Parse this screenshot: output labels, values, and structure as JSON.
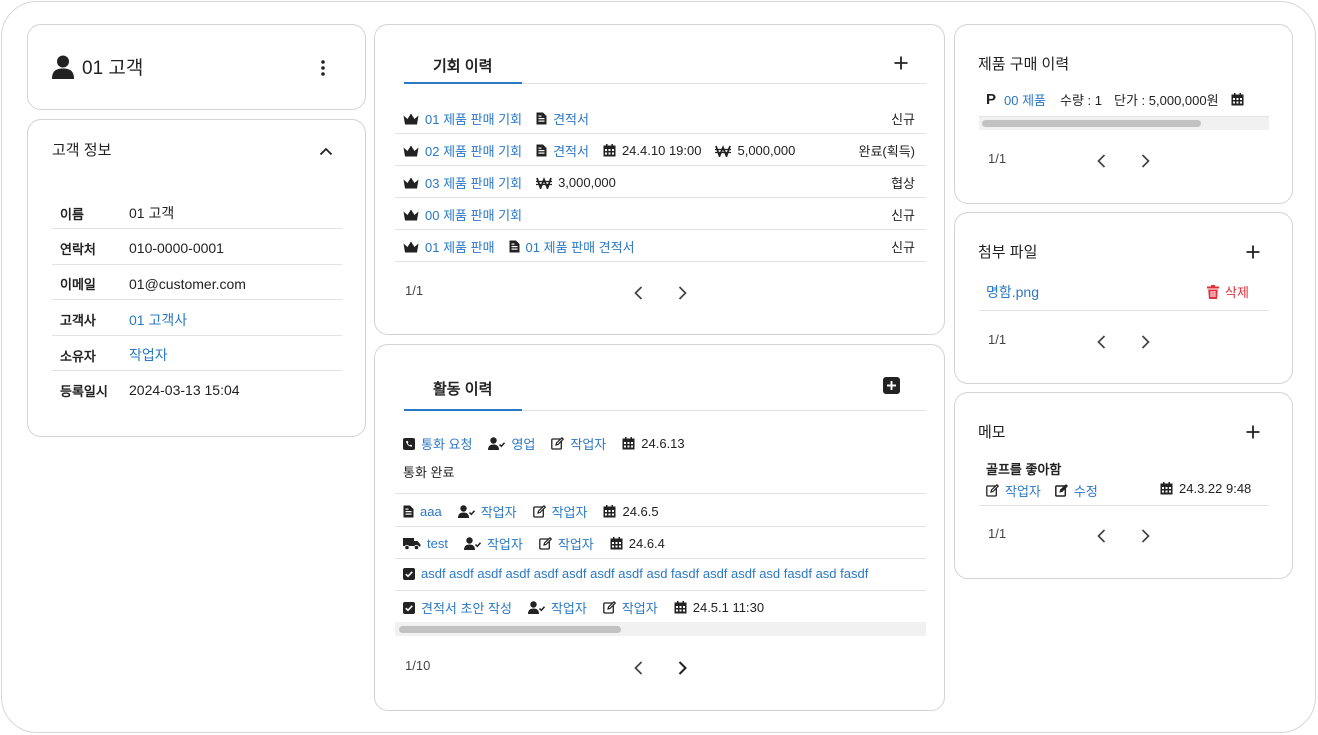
{
  "customer_card": {
    "title": "01 고객"
  },
  "info_card": {
    "title": "고객 정보",
    "rows": [
      {
        "label": "이름",
        "value": "01 고객"
      },
      {
        "label": "연락처",
        "value": "010-0000-0001"
      },
      {
        "label": "이메일",
        "value": "01@customer.com"
      },
      {
        "label": "고객사",
        "value": "01 고객사"
      },
      {
        "label": "소유자",
        "value": "작업자"
      },
      {
        "label": "등록일시",
        "value": "2024-03-13 15:04"
      }
    ]
  },
  "opportunity": {
    "title": "기회 이력",
    "rows": [
      {
        "name": "01 제품 판매 기회",
        "doc": "견적서",
        "status": "신규"
      },
      {
        "name": "02 제품 판매 기회",
        "doc": "견적서",
        "date": "24.4.10 19:00",
        "amount": "5,000,000",
        "status": "완료(획득)"
      },
      {
        "name": "03 제품 판매 기회",
        "amount": "3,000,000",
        "status": "협상"
      },
      {
        "name": "00 제품 판매 기회",
        "status": "신규"
      },
      {
        "name": "01 제품 판매",
        "doc": "01 제품 판매 견적서",
        "status": "신규"
      }
    ],
    "page": "1/1"
  },
  "activity": {
    "title": "활동 이력",
    "rows": [
      {
        "name": "통화 요청",
        "type": "영업",
        "author": "작업자",
        "date": "24.6.13",
        "note": "통화 완료"
      },
      {
        "name": "aaa",
        "type": "작업자",
        "author": "작업자",
        "date": "24.6.5"
      },
      {
        "name": "test",
        "type": "작업자",
        "author": "작업자",
        "date": "24.6.4"
      },
      {
        "name": "asdf asdf asdf asdf asdf asdf asdf asdf asd fasdf asdf asdf asd fasdf asd fasdf"
      },
      {
        "name": "견적서 초안 작성",
        "type": "작업자",
        "author": "작업자",
        "date": "24.5.1 11:30"
      }
    ],
    "page": "1/10"
  },
  "purchase": {
    "title": "제품 구매 이력",
    "item": {
      "mark": "P",
      "name": "00 제품",
      "qty": "수량 : 1",
      "price": "단가 : 5,000,000원"
    },
    "page": "1/1"
  },
  "attachments": {
    "title": "첨부 파일",
    "file": "명함.png",
    "delete_label": "삭제",
    "page": "1/1"
  },
  "memo": {
    "title": "메모",
    "text": "골프를 좋아함",
    "author": "작업자",
    "edit_label": "수정",
    "date": "24.3.22 9:48",
    "page": "1/1"
  },
  "colors": {
    "link": "#2b78c5",
    "delete": "#e0313b",
    "border": "#d3d3d3"
  }
}
